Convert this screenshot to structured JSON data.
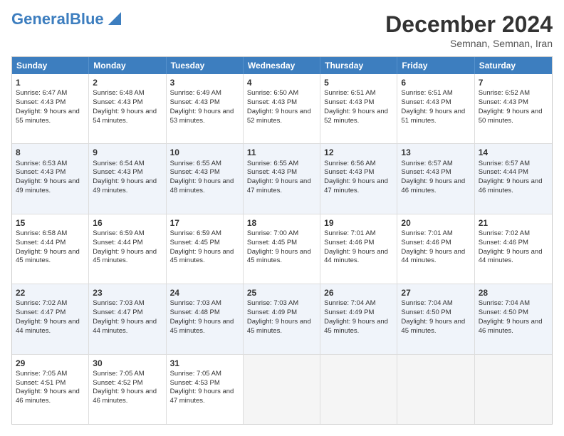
{
  "header": {
    "logo_general": "General",
    "logo_blue": "Blue",
    "month_title": "December 2024",
    "location": "Semnan, Semnan, Iran"
  },
  "weekdays": [
    "Sunday",
    "Monday",
    "Tuesday",
    "Wednesday",
    "Thursday",
    "Friday",
    "Saturday"
  ],
  "rows": [
    [
      {
        "day": "1",
        "sunrise": "Sunrise: 6:47 AM",
        "sunset": "Sunset: 4:43 PM",
        "daylight": "Daylight: 9 hours and 55 minutes."
      },
      {
        "day": "2",
        "sunrise": "Sunrise: 6:48 AM",
        "sunset": "Sunset: 4:43 PM",
        "daylight": "Daylight: 9 hours and 54 minutes."
      },
      {
        "day": "3",
        "sunrise": "Sunrise: 6:49 AM",
        "sunset": "Sunset: 4:43 PM",
        "daylight": "Daylight: 9 hours and 53 minutes."
      },
      {
        "day": "4",
        "sunrise": "Sunrise: 6:50 AM",
        "sunset": "Sunset: 4:43 PM",
        "daylight": "Daylight: 9 hours and 52 minutes."
      },
      {
        "day": "5",
        "sunrise": "Sunrise: 6:51 AM",
        "sunset": "Sunset: 4:43 PM",
        "daylight": "Daylight: 9 hours and 52 minutes."
      },
      {
        "day": "6",
        "sunrise": "Sunrise: 6:51 AM",
        "sunset": "Sunset: 4:43 PM",
        "daylight": "Daylight: 9 hours and 51 minutes."
      },
      {
        "day": "7",
        "sunrise": "Sunrise: 6:52 AM",
        "sunset": "Sunset: 4:43 PM",
        "daylight": "Daylight: 9 hours and 50 minutes."
      }
    ],
    [
      {
        "day": "8",
        "sunrise": "Sunrise: 6:53 AM",
        "sunset": "Sunset: 4:43 PM",
        "daylight": "Daylight: 9 hours and 49 minutes."
      },
      {
        "day": "9",
        "sunrise": "Sunrise: 6:54 AM",
        "sunset": "Sunset: 4:43 PM",
        "daylight": "Daylight: 9 hours and 49 minutes."
      },
      {
        "day": "10",
        "sunrise": "Sunrise: 6:55 AM",
        "sunset": "Sunset: 4:43 PM",
        "daylight": "Daylight: 9 hours and 48 minutes."
      },
      {
        "day": "11",
        "sunrise": "Sunrise: 6:55 AM",
        "sunset": "Sunset: 4:43 PM",
        "daylight": "Daylight: 9 hours and 47 minutes."
      },
      {
        "day": "12",
        "sunrise": "Sunrise: 6:56 AM",
        "sunset": "Sunset: 4:43 PM",
        "daylight": "Daylight: 9 hours and 47 minutes."
      },
      {
        "day": "13",
        "sunrise": "Sunrise: 6:57 AM",
        "sunset": "Sunset: 4:43 PM",
        "daylight": "Daylight: 9 hours and 46 minutes."
      },
      {
        "day": "14",
        "sunrise": "Sunrise: 6:57 AM",
        "sunset": "Sunset: 4:44 PM",
        "daylight": "Daylight: 9 hours and 46 minutes."
      }
    ],
    [
      {
        "day": "15",
        "sunrise": "Sunrise: 6:58 AM",
        "sunset": "Sunset: 4:44 PM",
        "daylight": "Daylight: 9 hours and 45 minutes."
      },
      {
        "day": "16",
        "sunrise": "Sunrise: 6:59 AM",
        "sunset": "Sunset: 4:44 PM",
        "daylight": "Daylight: 9 hours and 45 minutes."
      },
      {
        "day": "17",
        "sunrise": "Sunrise: 6:59 AM",
        "sunset": "Sunset: 4:45 PM",
        "daylight": "Daylight: 9 hours and 45 minutes."
      },
      {
        "day": "18",
        "sunrise": "Sunrise: 7:00 AM",
        "sunset": "Sunset: 4:45 PM",
        "daylight": "Daylight: 9 hours and 45 minutes."
      },
      {
        "day": "19",
        "sunrise": "Sunrise: 7:01 AM",
        "sunset": "Sunset: 4:46 PM",
        "daylight": "Daylight: 9 hours and 44 minutes."
      },
      {
        "day": "20",
        "sunrise": "Sunrise: 7:01 AM",
        "sunset": "Sunset: 4:46 PM",
        "daylight": "Daylight: 9 hours and 44 minutes."
      },
      {
        "day": "21",
        "sunrise": "Sunrise: 7:02 AM",
        "sunset": "Sunset: 4:46 PM",
        "daylight": "Daylight: 9 hours and 44 minutes."
      }
    ],
    [
      {
        "day": "22",
        "sunrise": "Sunrise: 7:02 AM",
        "sunset": "Sunset: 4:47 PM",
        "daylight": "Daylight: 9 hours and 44 minutes."
      },
      {
        "day": "23",
        "sunrise": "Sunrise: 7:03 AM",
        "sunset": "Sunset: 4:47 PM",
        "daylight": "Daylight: 9 hours and 44 minutes."
      },
      {
        "day": "24",
        "sunrise": "Sunrise: 7:03 AM",
        "sunset": "Sunset: 4:48 PM",
        "daylight": "Daylight: 9 hours and 45 minutes."
      },
      {
        "day": "25",
        "sunrise": "Sunrise: 7:03 AM",
        "sunset": "Sunset: 4:49 PM",
        "daylight": "Daylight: 9 hours and 45 minutes."
      },
      {
        "day": "26",
        "sunrise": "Sunrise: 7:04 AM",
        "sunset": "Sunset: 4:49 PM",
        "daylight": "Daylight: 9 hours and 45 minutes."
      },
      {
        "day": "27",
        "sunrise": "Sunrise: 7:04 AM",
        "sunset": "Sunset: 4:50 PM",
        "daylight": "Daylight: 9 hours and 45 minutes."
      },
      {
        "day": "28",
        "sunrise": "Sunrise: 7:04 AM",
        "sunset": "Sunset: 4:50 PM",
        "daylight": "Daylight: 9 hours and 46 minutes."
      }
    ],
    [
      {
        "day": "29",
        "sunrise": "Sunrise: 7:05 AM",
        "sunset": "Sunset: 4:51 PM",
        "daylight": "Daylight: 9 hours and 46 minutes."
      },
      {
        "day": "30",
        "sunrise": "Sunrise: 7:05 AM",
        "sunset": "Sunset: 4:52 PM",
        "daylight": "Daylight: 9 hours and 46 minutes."
      },
      {
        "day": "31",
        "sunrise": "Sunrise: 7:05 AM",
        "sunset": "Sunset: 4:53 PM",
        "daylight": "Daylight: 9 hours and 47 minutes."
      },
      null,
      null,
      null,
      null
    ]
  ]
}
